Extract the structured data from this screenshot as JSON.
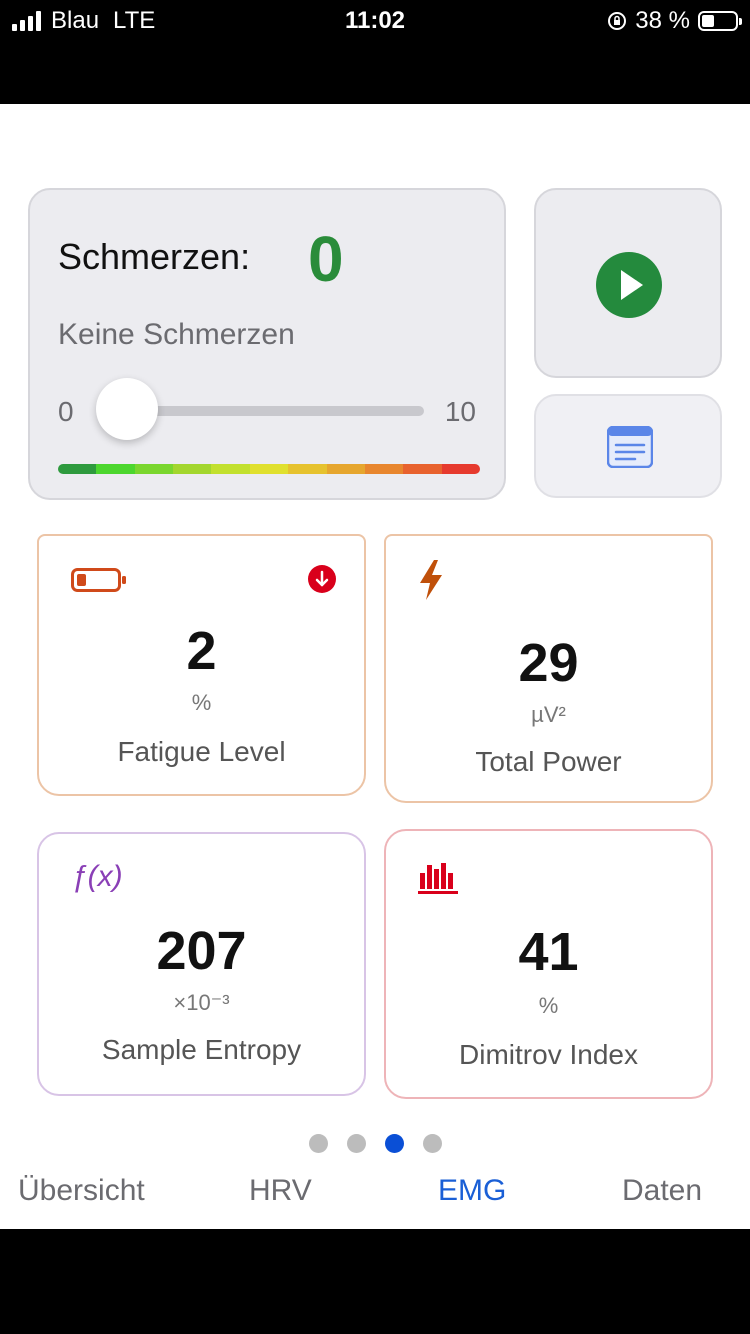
{
  "status_bar": {
    "carrier": "Blau",
    "network": "LTE",
    "time": "11:02",
    "battery_percent": "38 %",
    "battery_level": 0.38
  },
  "pain": {
    "label": "Schmerzen:",
    "value": "0",
    "description": "Keine Schmerzen",
    "slider_min": "0",
    "slider_max": "10",
    "slider_value": 0,
    "scale_colors": [
      "#2e9a3e",
      "#4cd62e",
      "#7ad62e",
      "#a3d62e",
      "#c2e02e",
      "#e0e02e",
      "#e6c22e",
      "#e6a62e",
      "#e8862e",
      "#e8622e",
      "#e63a2e"
    ]
  },
  "actions": {
    "play_icon": "play-icon",
    "notes_icon": "notes-icon"
  },
  "metrics": [
    {
      "label": "Fatigue Level",
      "value": "2",
      "unit": "%",
      "icon": "battery-low-icon",
      "badge": "arrow-down-icon",
      "border": "#ecc4a6"
    },
    {
      "label": "Total Power",
      "value": "29",
      "unit": "µV²",
      "icon": "bolt-icon",
      "border": "#ecc4a6"
    },
    {
      "label": "Sample Entropy",
      "value": "207",
      "unit": "×10⁻³",
      "icon": "function-icon",
      "icon_text": "ƒ(x)",
      "border": "#d8c4e6"
    },
    {
      "label": "Dimitrov Index",
      "value": "41",
      "unit": "%",
      "icon": "bar-chart-icon",
      "border": "#eeb4b8"
    }
  ],
  "page_indicator": {
    "count": 4,
    "active": 3
  },
  "tabs": [
    {
      "label": "Übersicht"
    },
    {
      "label": "HRV"
    },
    {
      "label": "EMG"
    },
    {
      "label": "Daten"
    }
  ],
  "active_tab": "EMG"
}
